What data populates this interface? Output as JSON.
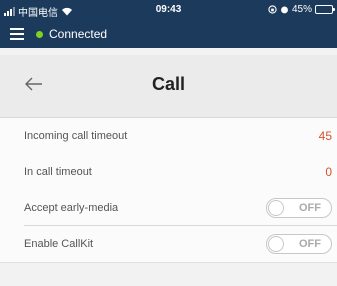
{
  "status_bar": {
    "carrier": "中国电信",
    "time": "09:43",
    "battery_text": "45%",
    "battery_level": 0.45
  },
  "app_bar": {
    "connection_status": "Connected"
  },
  "page": {
    "title": "Call"
  },
  "settings": [
    {
      "label": "Incoming call timeout",
      "value": "45"
    },
    {
      "label": "In call timeout",
      "value": "0"
    },
    {
      "label": "Accept early-media",
      "toggle_label": "OFF",
      "toggle_on": false
    },
    {
      "label": "Enable CallKit",
      "toggle_label": "OFF",
      "toggle_on": false
    }
  ],
  "colors": {
    "header_bg": "#1b3a5c",
    "connected_dot": "#7ed321",
    "value_text": "#d9522b"
  },
  "icons": [
    "signal-icon",
    "wifi-icon",
    "alarm-icon",
    "battery-icon",
    "menu-icon",
    "back-arrow-icon"
  ]
}
